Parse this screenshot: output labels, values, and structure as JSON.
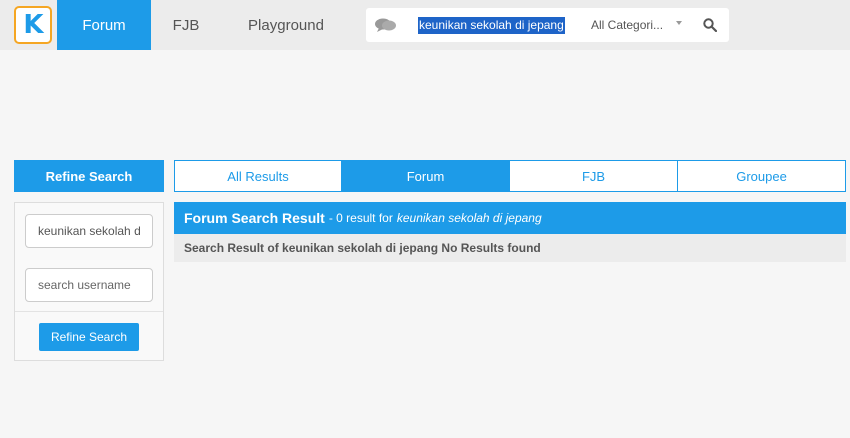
{
  "nav": {
    "items": [
      {
        "label": "Forum",
        "active": true
      },
      {
        "label": "FJB",
        "active": false
      },
      {
        "label": "Playground",
        "active": false
      }
    ]
  },
  "search": {
    "query": "keunikan sekolah di jepang",
    "category": "All Categori..."
  },
  "sidebar": {
    "header": "Refine Search",
    "keyword_value": "keunikan sekolah di jepang",
    "username_placeholder": "search username",
    "button_label": "Refine Search"
  },
  "tabs": [
    {
      "label": "All Results",
      "active": false
    },
    {
      "label": "Forum",
      "active": true
    },
    {
      "label": "FJB",
      "active": false
    },
    {
      "label": "Groupee",
      "active": false
    }
  ],
  "results": {
    "title": "Forum Search Result",
    "count_text": "- 0 result for",
    "query": "keunikan sekolah di jepang",
    "message": "Search Result of keunikan sekolah di jepang No Results found"
  },
  "colors": {
    "accent": "#1d9be8",
    "logo_border": "#f5a623",
    "selection": "#1e64c8"
  },
  "icons": {
    "logo": "kaskus-logo-icon",
    "chat": "chat-bubbles-icon",
    "search": "search-icon",
    "dropdown": "caret-down-icon"
  }
}
